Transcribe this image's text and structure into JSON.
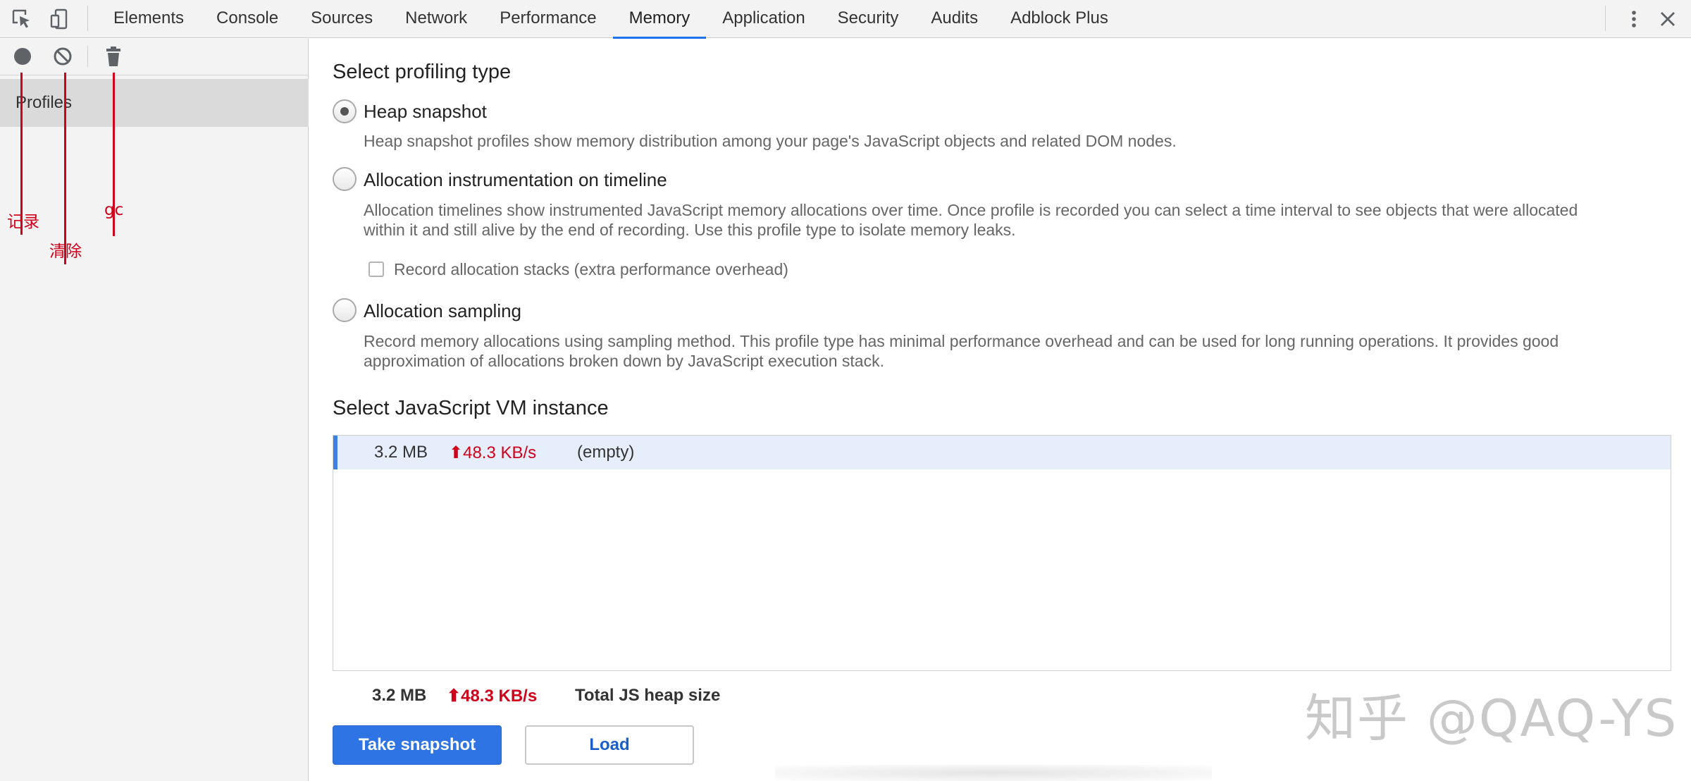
{
  "devtools": {
    "tabs": [
      {
        "label": "Elements"
      },
      {
        "label": "Console"
      },
      {
        "label": "Sources"
      },
      {
        "label": "Network"
      },
      {
        "label": "Performance"
      },
      {
        "label": "Memory",
        "active": true
      },
      {
        "label": "Application"
      },
      {
        "label": "Security"
      },
      {
        "label": "Audits"
      },
      {
        "label": "Adblock Plus"
      }
    ],
    "left_icons": [
      "inspect-element-icon",
      "device-toolbar-icon"
    ],
    "right_icons": [
      "more-options-icon",
      "close-icon"
    ]
  },
  "sidebar": {
    "toolbar_icons": [
      "record-icon",
      "clear-icon",
      "collect-garbage-icon"
    ],
    "profiles_label": "Profiles",
    "annotations": {
      "record": "记录",
      "clear": "清除",
      "gc": "gc"
    },
    "annotation_color": "#d0021b"
  },
  "main": {
    "profiling_heading": "Select profiling type",
    "options": [
      {
        "label": "Heap snapshot",
        "checked": true,
        "description": "Heap snapshot profiles show memory distribution among your page's JavaScript objects and related DOM nodes."
      },
      {
        "label": "Allocation instrumentation on timeline",
        "checked": false,
        "description": "Allocation timelines show instrumented JavaScript memory allocations over time. Once profile is recorded you can select a time interval to see objects that were allocated within it and still alive by the end of recording. Use this profile type to isolate memory leaks.",
        "checkbox_label": "Record allocation stacks (extra performance overhead)",
        "checkbox_checked": false
      },
      {
        "label": "Allocation sampling",
        "checked": false,
        "description": "Record memory allocations using sampling method. This profile type has minimal performance overhead and can be used for long running operations. It provides good approximation of allocations broken down by JavaScript execution stack."
      }
    ],
    "vm_heading": "Select JavaScript VM instance",
    "vm_instances": [
      {
        "size": "3.2 MB",
        "rate": "⬆48.3 KB/s",
        "name": "(empty)",
        "selected": true
      }
    ],
    "total": {
      "size": "3.2 MB",
      "rate": "⬆48.3 KB/s",
      "label": "Total JS heap size"
    },
    "take_snapshot_label": "Take snapshot",
    "load_label": "Load"
  },
  "watermark": "知乎 @QAQ-YS",
  "colors": {
    "accent": "#1a73e8",
    "primary_button": "#2f74e4",
    "rate_red": "#d0021b",
    "selected_row": "#e6eefb"
  }
}
